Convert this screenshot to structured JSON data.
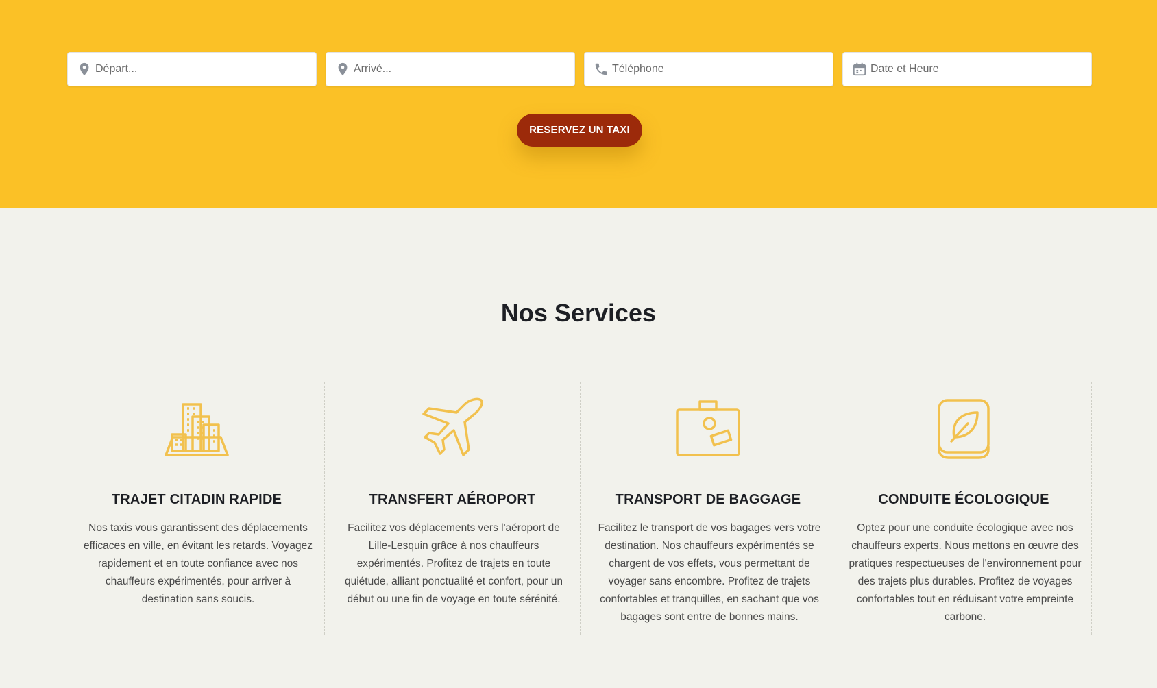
{
  "booking": {
    "fields": [
      {
        "icon": "map-pin-icon",
        "placeholder": "Départ..."
      },
      {
        "icon": "map-pin-icon",
        "placeholder": "Arrivé..."
      },
      {
        "icon": "phone-icon",
        "placeholder": "Téléphone"
      },
      {
        "icon": "calendar-icon",
        "placeholder": "Date et Heure"
      }
    ],
    "button_label": "RESERVEZ UN TAXI"
  },
  "services": {
    "title": "Nos Services",
    "items": [
      {
        "icon": "city-buildings-icon",
        "title": "TRAJET CITADIN RAPIDE",
        "text": "Nos taxis vous garantissent des déplacements efficaces en ville, en évitant les retards. Voyagez rapidement et en toute confiance avec nos chauffeurs expérimentés, pour arriver à destination sans soucis."
      },
      {
        "icon": "airplane-icon",
        "title": "TRANSFERT AÉROPORT",
        "text": "Facilitez vos déplacements vers l'aéroport de Lille-Lesquin grâce à nos chauffeurs expérimentés. Profitez de trajets en toute quiétude, alliant ponctualité et confort, pour un début ou une fin de voyage en toute sérénité."
      },
      {
        "icon": "suitcase-icon",
        "title": "TRANSPORT DE BAGGAGE",
        "text": "Facilitez le transport de vos bagages vers votre destination. Nos chauffeurs expérimentés se chargent de vos effets, vous permettant de voyager sans encombre. Profitez de trajets confortables et tranquilles, en sachant que vos bagages sont entre de bonnes mains."
      },
      {
        "icon": "leaf-app-icon",
        "title": "CONDUITE ÉCOLOGIQUE",
        "text": "Optez pour une conduite écologique avec nos chauffeurs experts. Nous mettons en œuvre des pratiques respectueuses de l'environnement pour des trajets plus durables. Profitez de voyages confortables tout en réduisant votre empreinte carbone."
      }
    ]
  },
  "colors": {
    "hero_background": "#fbc126",
    "button_background": "#9c2a0a",
    "icon_color": "#f2c14e",
    "page_background": "#f2f2ec"
  }
}
